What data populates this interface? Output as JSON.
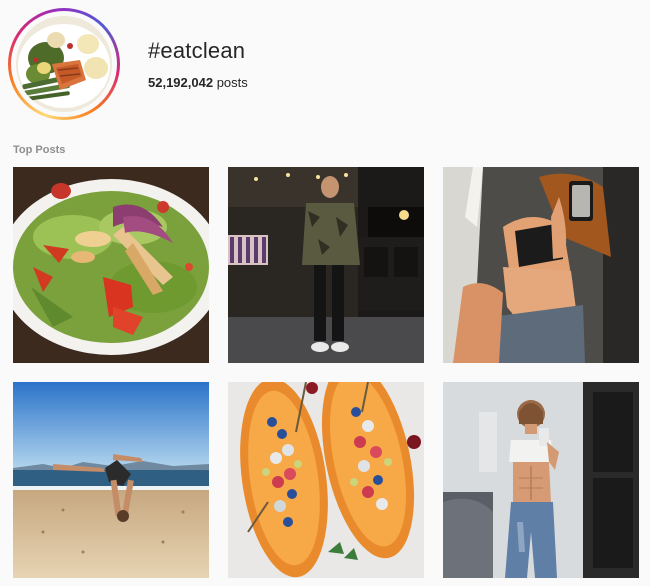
{
  "hashtag": {
    "title": "#eatclean",
    "post_count": "52,192,042",
    "post_suffix": " posts"
  },
  "sections": {
    "top_posts_label": "Top Posts"
  },
  "posts": [
    {
      "subject": "salad-plate"
    },
    {
      "subject": "man-in-restaurant"
    },
    {
      "subject": "mirror-selfie-woman"
    },
    {
      "subject": "beach-yoga-pose"
    },
    {
      "subject": "papaya-boats-with-berries"
    },
    {
      "subject": "mirror-selfie-fitness"
    }
  ],
  "colors": {
    "ring_gradient": [
      "#feda75",
      "#fa7e1e",
      "#d62976",
      "#962fbf",
      "#4f5bd5"
    ],
    "muted_text": "#8e8e8e",
    "primary_text": "#262626"
  }
}
